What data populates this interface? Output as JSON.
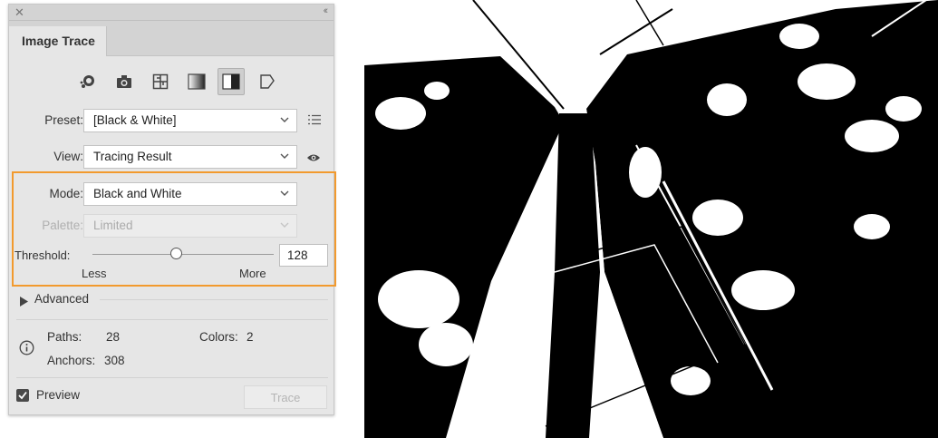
{
  "panel": {
    "title_tab": "Image Trace",
    "icons": [
      "auto-color-icon",
      "camera-icon",
      "grid-icon",
      "grayscale-icon",
      "black-white-icon",
      "outline-icon"
    ],
    "preset_label": "Preset:",
    "preset_value": "[Black & White]",
    "view_label": "View:",
    "view_value": "Tracing Result",
    "mode_label": "Mode:",
    "mode_value": "Black and White",
    "palette_label": "Palette:",
    "palette_value": "Limited",
    "threshold_label": "Threshold:",
    "threshold_value": "128",
    "threshold_fraction": 0.5,
    "less_label": "Less",
    "more_label": "More",
    "advanced_label": "Advanced",
    "paths_label": "Paths:",
    "paths_value": "28",
    "colors_label": "Colors:",
    "colors_value": "2",
    "anchors_label": "Anchors:",
    "anchors_value": "308",
    "preview_label": "Preview",
    "trace_label": "Trace"
  },
  "colors": {
    "highlight": "#f29a2e",
    "panel_bg": "#e6e6e6"
  }
}
